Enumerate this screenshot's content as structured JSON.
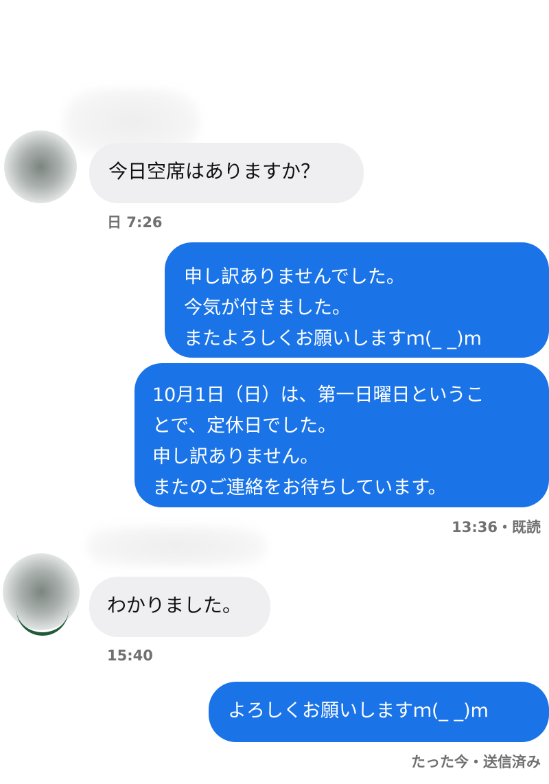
{
  "messages": [
    {
      "direction": "incoming",
      "text": "今日空席はありますか？",
      "meta": "日 7:26"
    },
    {
      "direction": "outgoing",
      "lines": [
        "申し訳ありませんでした。",
        "今気が付きました。",
        "またよろしくお願いしますｍ(_ _)m"
      ]
    },
    {
      "direction": "outgoing",
      "lines": [
        "10月1日（日）は、第一日曜日というこ",
        "とで、定休日でした。",
        "申し訳ありません。",
        "またのご連絡をお待ちしています。"
      ],
      "meta": "13:36・既読"
    },
    {
      "direction": "incoming",
      "text": "わかりました。",
      "meta": "15:40"
    },
    {
      "direction": "outgoing",
      "text": "よろしくお願いしますｍ(_ _)m",
      "meta": "たった今・送信済み"
    }
  ],
  "colors": {
    "outgoing_bubble": "#1a74e8",
    "incoming_bubble": "#efeff2",
    "meta_text": "#707070"
  }
}
